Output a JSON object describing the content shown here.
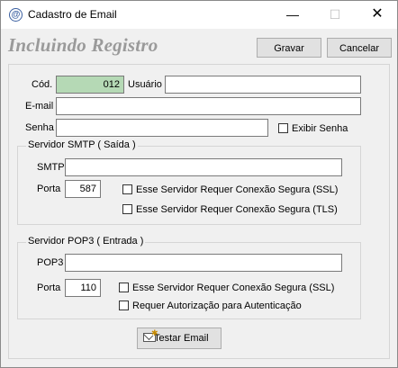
{
  "window": {
    "title": "Cadastro de Email",
    "app_icon": "at-sign-icon",
    "minimize": "—",
    "maximize": "☐",
    "close": "✕"
  },
  "header": {
    "heading": "Incluindo Registro",
    "save_label": "Gravar",
    "cancel_label": "Cancelar"
  },
  "form": {
    "cod_label": "Cód.",
    "cod_value": "012",
    "usuario_label": "Usuário",
    "usuario_value": "",
    "email_label": "E-mail",
    "email_value": "",
    "senha_label": "Senha",
    "senha_value": "",
    "exibir_senha_label": "Exibir Senha",
    "exibir_senha_checked": false
  },
  "smtp": {
    "group_title": "Servidor SMTP ( Saída )",
    "smtp_label": "SMTP",
    "smtp_value": "",
    "porta_label": "Porta",
    "porta_value": "587",
    "ssl_label": "Esse Servidor Requer Conexão Segura (SSL)",
    "ssl_checked": false,
    "tls_label": "Esse Servidor Requer Conexão Segura (TLS)",
    "tls_checked": false
  },
  "pop3": {
    "group_title": "Servidor POP3 ( Entrada )",
    "pop3_label": "POP3",
    "pop3_value": "",
    "porta_label": "Porta",
    "porta_value": "110",
    "ssl_label": "Esse Servidor Requer Conexão Segura (SSL)",
    "ssl_checked": false,
    "auth_label": "Requer Autorização para Autenticação",
    "auth_checked": false
  },
  "actions": {
    "test_label": "Testar Email",
    "test_icon": "mail-icon"
  }
}
